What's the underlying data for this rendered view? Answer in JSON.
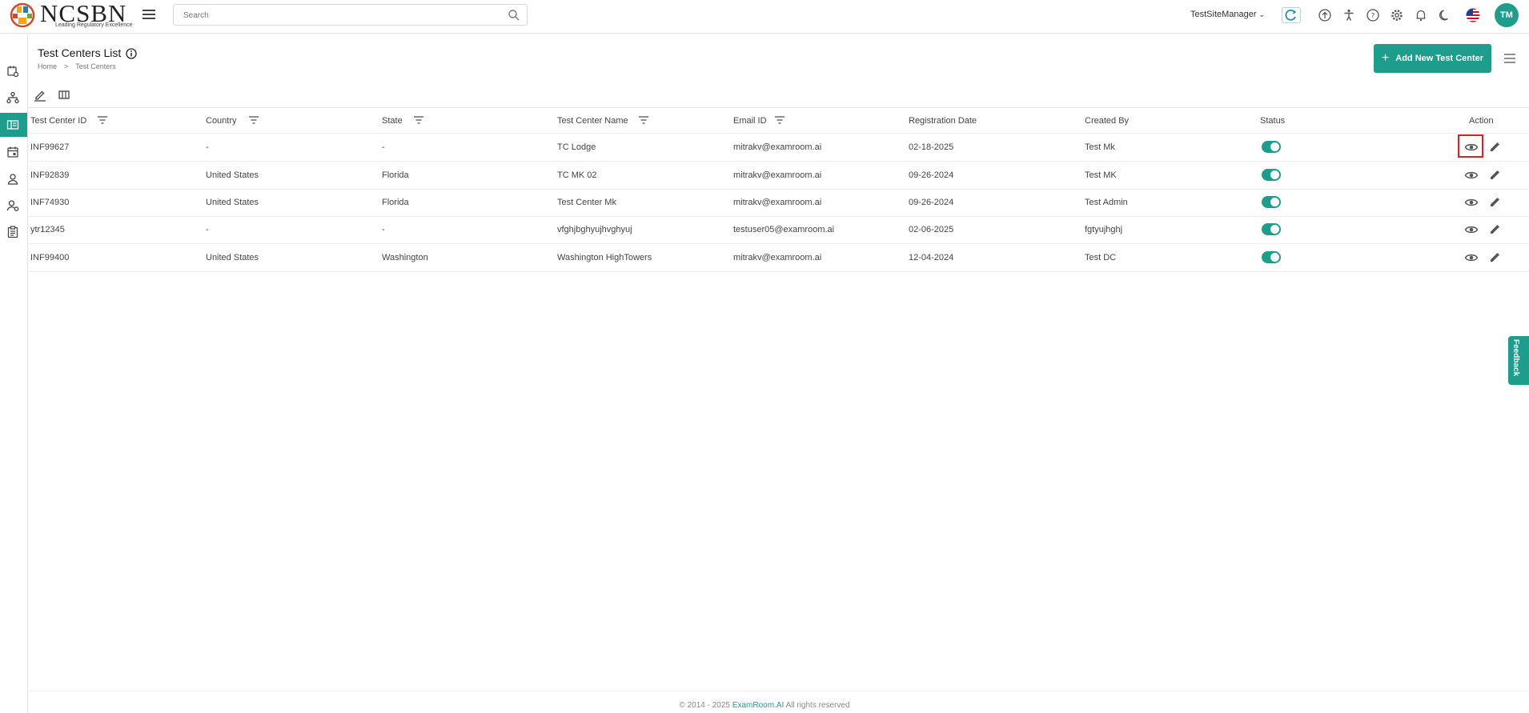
{
  "brand": {
    "name": "NCSBN",
    "tagline": "Leading Regulatory Excellence"
  },
  "header": {
    "search_placeholder": "Search",
    "user_name": "TestSiteManager",
    "avatar_initials": "TM",
    "icons": [
      "upload-circle-icon",
      "accessibility-icon",
      "help-icon",
      "settings-icon",
      "bell-icon",
      "moon-icon",
      "us-flag-icon"
    ]
  },
  "sidebar": {
    "items": [
      {
        "icon": "calendar-settings-icon"
      },
      {
        "icon": "hierarchy-icon"
      },
      {
        "icon": "test-center-icon",
        "active": true
      },
      {
        "icon": "calendar-icon"
      },
      {
        "icon": "user-icon"
      },
      {
        "icon": "user-settings-icon"
      },
      {
        "icon": "clipboard-icon"
      }
    ]
  },
  "page": {
    "title": "Test Centers List",
    "breadcrumb": {
      "home": "Home",
      "sep": ">",
      "current": "Test Centers"
    },
    "add_button": "Add New Test Center"
  },
  "table": {
    "headers": {
      "id": "Test Center ID",
      "country": "Country",
      "state": "State",
      "name": "Test Center Name",
      "email": "Email ID",
      "reg_date": "Registration Date",
      "created_by": "Created By",
      "status": "Status",
      "action": "Action"
    },
    "rows": [
      {
        "id": "INF99627",
        "country": "-",
        "state": "-",
        "name": "TC Lodge",
        "email": "mitrakv@examroom.ai",
        "reg_date": "02-18-2025",
        "created_by": "Test Mk",
        "status": true
      },
      {
        "id": "INF92839",
        "country": "United States",
        "state": "Florida",
        "name": "TC MK 02",
        "email": "mitrakv@examroom.ai",
        "reg_date": "09-26-2024",
        "created_by": "Test MK",
        "status": true
      },
      {
        "id": "INF74930",
        "country": "United States",
        "state": "Florida",
        "name": "Test Center Mk",
        "email": "mitrakv@examroom.ai",
        "reg_date": "09-26-2024",
        "created_by": "Test Admin",
        "status": true
      },
      {
        "id": "ytr12345",
        "country": "-",
        "state": "-",
        "name": "vfghjbghyujhvghyuj",
        "email": "testuser05@examroom.ai",
        "reg_date": "02-06-2025",
        "created_by": "fgtyujhghj",
        "status": true
      },
      {
        "id": "INF99400",
        "country": "United States",
        "state": "Washington",
        "name": "Washington HighTowers",
        "email": "mitrakv@examroom.ai",
        "reg_date": "12-04-2024",
        "created_by": "Test DC",
        "status": true
      }
    ]
  },
  "feedback_label": "Feedback",
  "footer": {
    "prefix": "© 2014 - 2025",
    "link": "ExamRoom.AI",
    "suffix": "All rights reserved"
  },
  "colors": {
    "accent": "#1e9c8c",
    "highlight": "#e02020"
  }
}
